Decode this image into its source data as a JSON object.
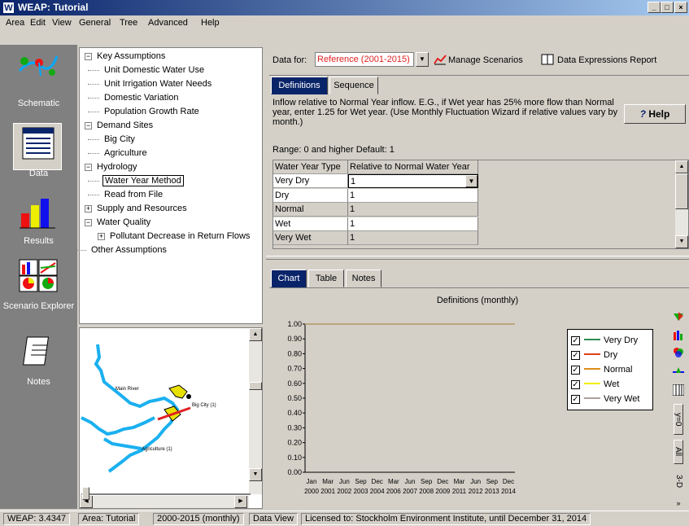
{
  "window": {
    "title": "WEAP: Tutorial",
    "icon_letter": "W",
    "min_glyph": "_",
    "max_glyph": "□",
    "close_glyph": "×"
  },
  "menu": [
    "Area",
    "Edit",
    "View",
    "General",
    "Tree",
    "Advanced",
    "Help"
  ],
  "sidebar": [
    {
      "label": "Schematic"
    },
    {
      "label": "Data"
    },
    {
      "label": "Results"
    },
    {
      "label": "Scenario Explorer"
    },
    {
      "label": "Notes"
    }
  ],
  "tree": {
    "nodes": [
      {
        "label": "Key Assumptions",
        "depth": 0,
        "expander": "−"
      },
      {
        "label": "Unit Domestic Water Use",
        "depth": 1
      },
      {
        "label": "Unit Irrigation Water Needs",
        "depth": 1
      },
      {
        "label": "Domestic Variation",
        "depth": 1
      },
      {
        "label": "Population Growth Rate",
        "depth": 1
      },
      {
        "label": "Demand Sites",
        "depth": 0,
        "expander": "−"
      },
      {
        "label": "Big City",
        "depth": 1
      },
      {
        "label": "Agriculture",
        "depth": 1
      },
      {
        "label": "Hydrology",
        "depth": 0,
        "expander": "−"
      },
      {
        "label": "Water Year Method",
        "depth": 1,
        "selected": true
      },
      {
        "label": "Read from File",
        "depth": 1
      },
      {
        "label": "Supply and Resources",
        "depth": 0,
        "expander": "+"
      },
      {
        "label": "Water Quality",
        "depth": 0,
        "expander": "−"
      },
      {
        "label": "Pollutant Decrease in Return Flows",
        "depth": 1,
        "expander": "+"
      },
      {
        "label": "Other Assumptions",
        "depth": 0
      }
    ]
  },
  "map": {
    "labels": {
      "river": "Main River",
      "city": "Big City (1)",
      "agri": "Agriculture (1)"
    }
  },
  "toolbar": {
    "data_for_label": "Data for:",
    "scenario": "Reference (2001-2015)",
    "manage": "Manage Scenarios",
    "report": "Data Expressions Report"
  },
  "tabs_top": [
    {
      "label": "Definitions",
      "active": true
    },
    {
      "label": "Sequence",
      "active": false
    }
  ],
  "info": {
    "text": "Inflow relative to Normal Year inflow.  E.G., if Wet year has 25% more flow than Normal year, enter 1.25 for Wet year.  (Use Monthly Fluctuation Wizard if relative values vary by month.)",
    "range": "Range: 0 and higher   Default: 1",
    "help": "Help",
    "help_glyph": "?"
  },
  "grid": {
    "headers": [
      "Water Year Type",
      "Relative to Normal Water Year"
    ],
    "rows": [
      {
        "type": "Very Dry",
        "value": "1"
      },
      {
        "type": "Dry",
        "value": "1"
      },
      {
        "type": "Normal",
        "value": "1"
      },
      {
        "type": "Wet",
        "value": "1"
      },
      {
        "type": "Very Wet",
        "value": "1"
      }
    ]
  },
  "tabs_bottom": [
    {
      "label": "Chart",
      "active": true
    },
    {
      "label": "Table",
      "active": false
    },
    {
      "label": "Notes",
      "active": false
    }
  ],
  "chart_data": {
    "type": "line",
    "title": "Definitions (monthly)",
    "ylim": [
      0,
      1
    ],
    "yticks": [
      "1.00",
      "0.90",
      "0.80",
      "0.70",
      "0.60",
      "0.50",
      "0.40",
      "0.30",
      "0.20",
      "0.10",
      "0.00"
    ],
    "xticks_month": [
      "Jan",
      "Mar",
      "Jun",
      "Sep",
      "Dec",
      "Mar",
      "Jun",
      "Sep",
      "Dec",
      "Mar",
      "Jun",
      "Sep",
      "Dec"
    ],
    "xticks_year": [
      "2000",
      "2001",
      "2002",
      "2003",
      "2004",
      "2006",
      "2007",
      "2008",
      "2009",
      "2011",
      "2012",
      "2013",
      "2014"
    ],
    "series": [
      {
        "name": "Very Dry",
        "color": "#2e8b57",
        "value": 1
      },
      {
        "name": "Dry",
        "color": "#e0401a",
        "value": 1
      },
      {
        "name": "Normal",
        "color": "#e08c1a",
        "value": 1
      },
      {
        "name": "Wet",
        "color": "#f0f000",
        "value": 1
      },
      {
        "name": "Very Wet",
        "color": "#b0a0a0",
        "value": 1
      }
    ],
    "legend": "right"
  },
  "chart_tools": [
    "y=0",
    "All",
    "3-D"
  ],
  "status": [
    "WEAP: 3.4347",
    "Area: Tutorial",
    "2000-2015 (monthly)",
    "Data View",
    "Licensed to: Stockholm Environment Institute, until December 31, 2014"
  ]
}
